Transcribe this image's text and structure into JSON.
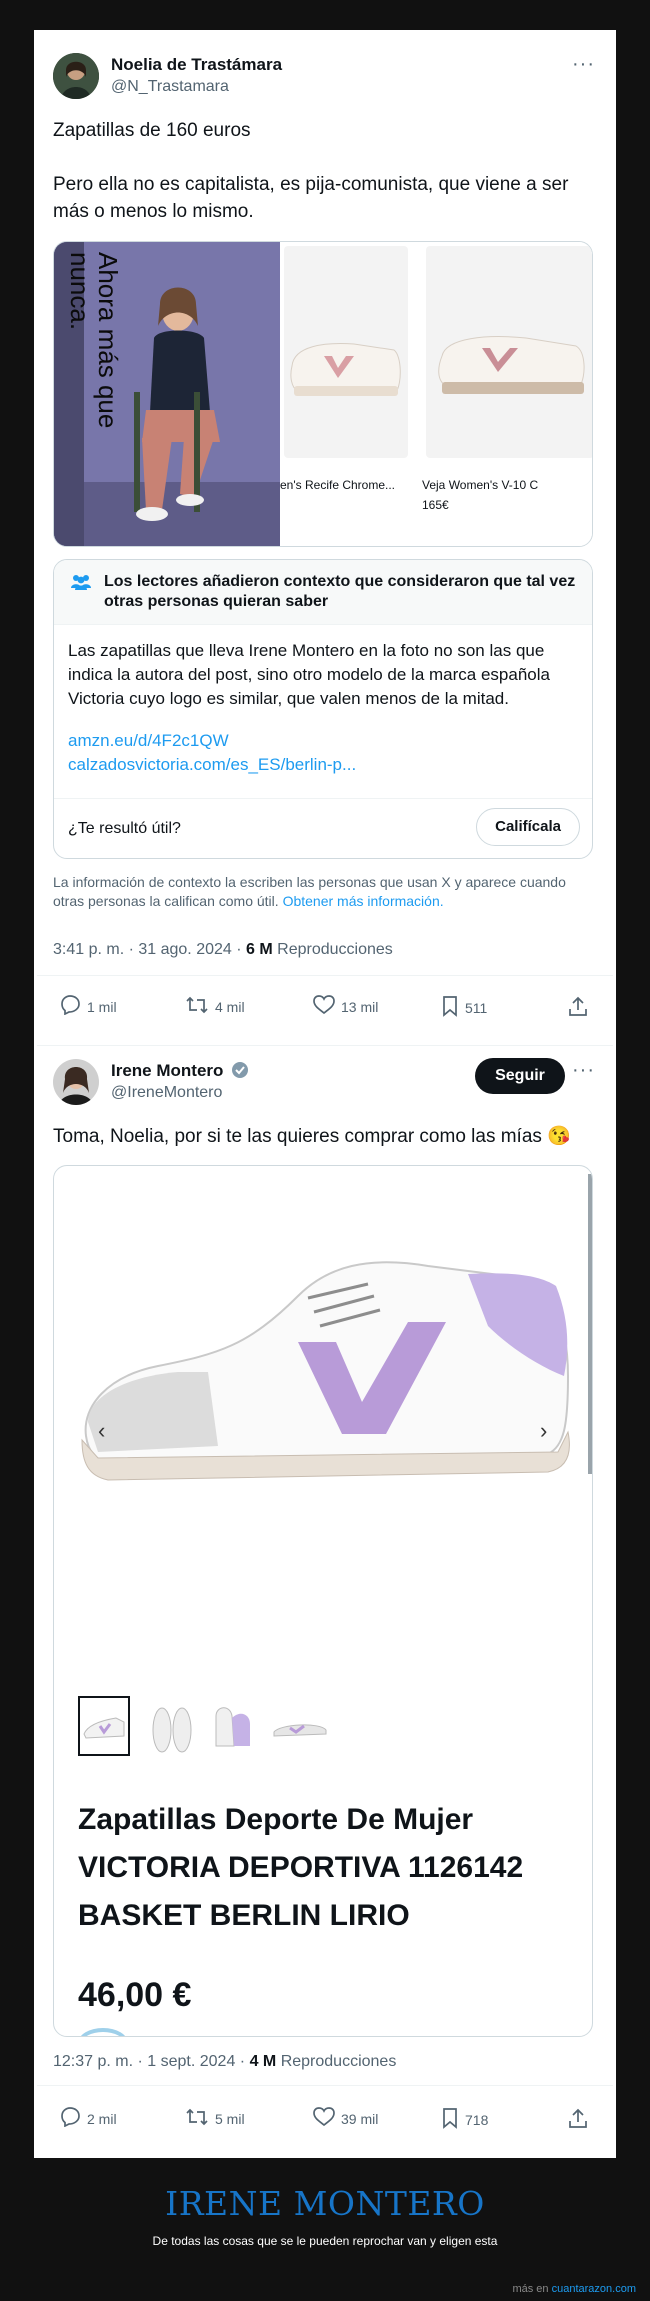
{
  "tweet1": {
    "author_name": "Noelia de Trastámara",
    "author_handle": "@N_Trastamara",
    "more": "···",
    "text_line1": "Zapatillas de 160 euros",
    "text_line2": "Pero ella no es capitalista, es pija-comunista, que viene a ser más o menos lo mismo.",
    "photo_overlay": "Ahora más que nunca.",
    "product1_caption": "en's Recife Chrome...",
    "product2_caption": "Veja Women's V-10 C",
    "product2_price": "165€",
    "note_header": "Los lectores añadieron contexto que consideraron que tal vez otras personas quieran saber",
    "note_body": "Las zapatillas que lleva Irene Montero en la foto no son las que indica la autora del post, sino otro modelo de la marca española Victoria cuyo logo es similar, que valen menos de la mitad.",
    "note_link1": "amzn.eu/d/4F2c1QW",
    "note_link2": "calzadosvictoria.com/es_ES/berlin-p...",
    "note_question": "¿Te resultó útil?",
    "note_rate": "Califícala",
    "note_footer": "La información de contexto la escriben las personas que usan X y aparece cuando otras personas la califican como útil.",
    "note_footer_link": "Obtener más información.",
    "timestamp": "3:41 p. m. · 31 ago. 2024 ·",
    "views_count": "6 M",
    "views_label": "Reproducciones",
    "replies": "1 mil",
    "reposts": "4 mil",
    "likes": "13 mil",
    "bookmarks": "511"
  },
  "tweet2": {
    "author_name": "Irene Montero",
    "author_handle": "@IreneMontero",
    "follow": "Seguir",
    "more": "···",
    "text": "Toma, Noelia, por si te las quieres comprar como las mías 😘",
    "product_title": "Zapatillas Deporte De Mujer VICTORIA DEPORTIVA 1126142 BASKET BERLIN LIRIO",
    "product_price": "46,00 €",
    "timestamp": "12:37 p. m. · 1 sept. 2024 ·",
    "views_count": "4 M",
    "views_label": "Reproducciones",
    "replies": "2 mil",
    "reposts": "5 mil",
    "likes": "39 mil",
    "bookmarks": "718"
  },
  "footer": {
    "title": "IRENE MONTERO",
    "subtitle": "De todas las cosas que se le pueden reprochar van y eligen esta",
    "source_prefix": "más en",
    "source_site": "cuantarazon.com"
  },
  "colors": {
    "link": "#1d9bf0",
    "lilac": "#b89bd8",
    "footer_title": "#1775c8"
  }
}
